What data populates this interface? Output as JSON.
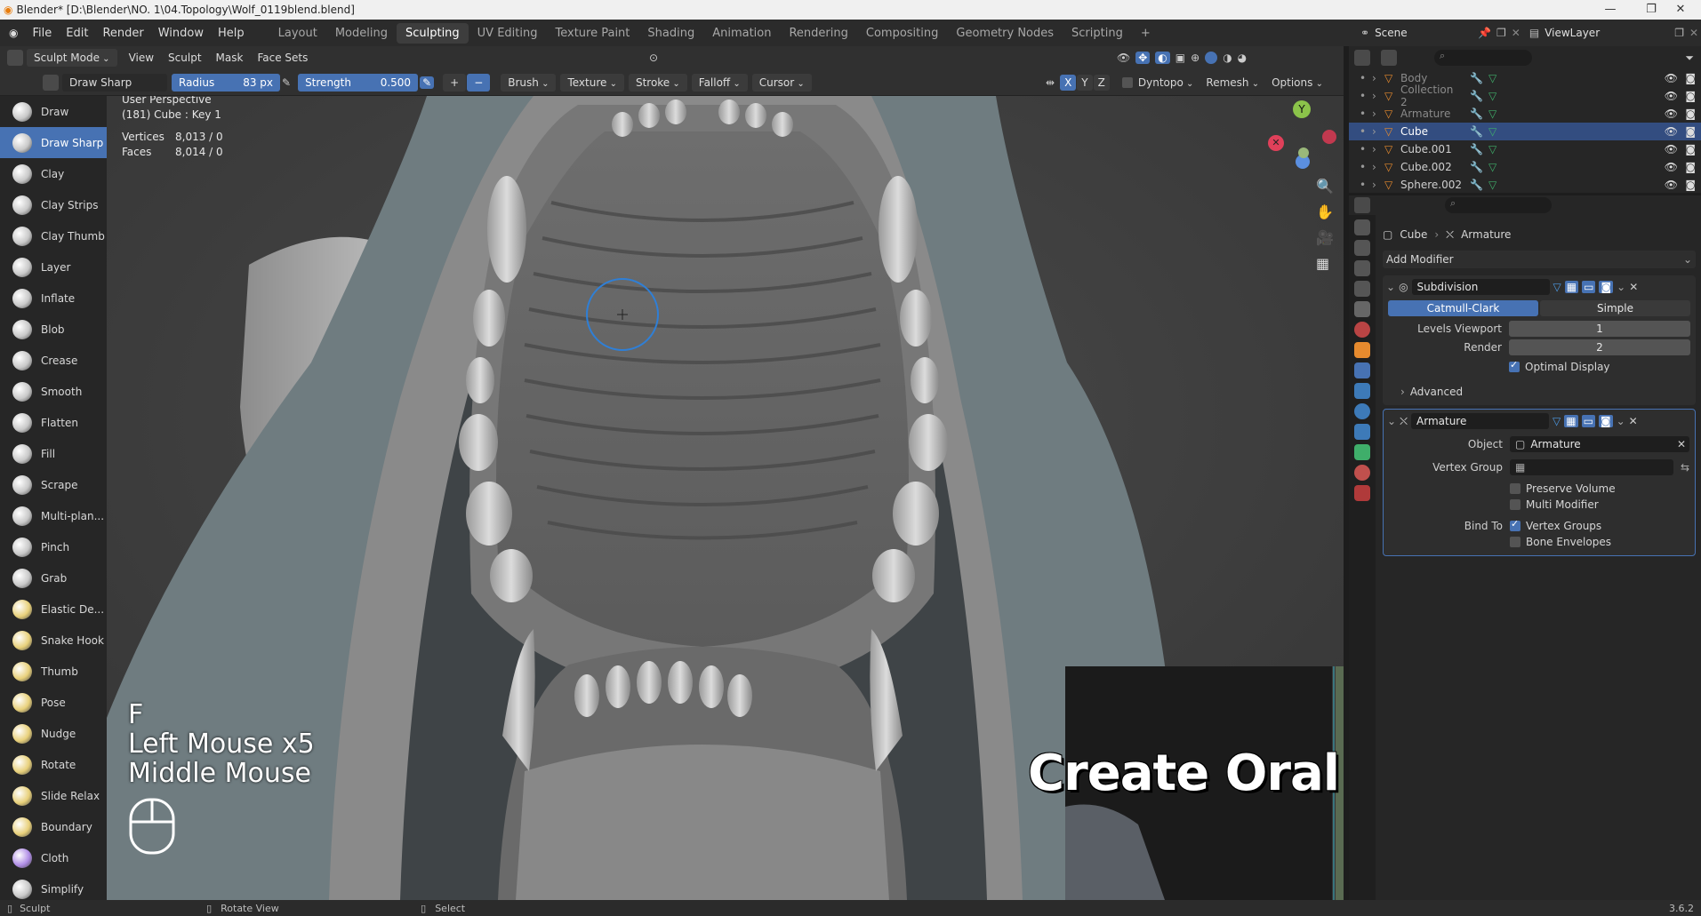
{
  "title": "Blender* [D:\\Blender\\NO. 1\\04.Topology\\Wolf_0119blend.blend]",
  "menu": [
    "File",
    "Edit",
    "Render",
    "Window",
    "Help"
  ],
  "workspaces": [
    "Layout",
    "Modeling",
    "Sculpting",
    "UV Editing",
    "Texture Paint",
    "Shading",
    "Animation",
    "Rendering",
    "Compositing",
    "Geometry Nodes",
    "Scripting"
  ],
  "active_workspace": "Sculpting",
  "scene": "Scene",
  "view_layer": "ViewLayer",
  "viewport_header": {
    "mode": "Sculpt Mode",
    "menus": [
      "View",
      "Sculpt",
      "Mask",
      "Face Sets"
    ]
  },
  "tool_header": {
    "brush_name": "Draw Sharp",
    "radius_label": "Radius",
    "radius_value": "83 px",
    "strength_label": "Strength",
    "strength_value": "0.500",
    "plus": "+",
    "minus": "−",
    "menus": [
      "Brush",
      "Texture",
      "Stroke",
      "Falloff",
      "Cursor"
    ],
    "axes": [
      "X",
      "Y",
      "Z"
    ],
    "dyntopo": "Dyntopo",
    "remesh": "Remesh",
    "options": "Options"
  },
  "tools": [
    {
      "label": "Draw",
      "color": "#c8c8c8"
    },
    {
      "label": "Draw Sharp",
      "color": "#c8c8c8",
      "active": true
    },
    {
      "label": "Clay",
      "color": "#c8c8c8"
    },
    {
      "label": "Clay Strips",
      "color": "#c8c8c8"
    },
    {
      "label": "Clay Thumb",
      "color": "#c8c8c8"
    },
    {
      "label": "Layer",
      "color": "#c8c8c8"
    },
    {
      "label": "Inflate",
      "color": "#c8c8c8"
    },
    {
      "label": "Blob",
      "color": "#c8c8c8"
    },
    {
      "label": "Crease",
      "color": "#c8c8c8"
    },
    {
      "label": "Smooth",
      "color": "#c8c8c8"
    },
    {
      "label": "Flatten",
      "color": "#c8c8c8"
    },
    {
      "label": "Fill",
      "color": "#c8c8c8"
    },
    {
      "label": "Scrape",
      "color": "#c8c8c8"
    },
    {
      "label": "Multi-plan...",
      "color": "#c8c8c8"
    },
    {
      "label": "Pinch",
      "color": "#c8c8c8"
    },
    {
      "label": "Grab",
      "color": "#c8c8c8"
    },
    {
      "label": "Elastic De...",
      "color": "#e8d07a"
    },
    {
      "label": "Snake Hook",
      "color": "#e8d07a"
    },
    {
      "label": "Thumb",
      "color": "#e8d07a"
    },
    {
      "label": "Pose",
      "color": "#e8d07a"
    },
    {
      "label": "Nudge",
      "color": "#e8d07a"
    },
    {
      "label": "Rotate",
      "color": "#e8d07a"
    },
    {
      "label": "Slide Relax",
      "color": "#e8d07a"
    },
    {
      "label": "Boundary",
      "color": "#e8d07a"
    },
    {
      "label": "Cloth",
      "color": "#b08de6"
    },
    {
      "label": "Simplify",
      "color": "#c8c8c8"
    }
  ],
  "viewport_info": {
    "line1": "User Perspective",
    "line2": "(181) Cube : Key 1",
    "vertices_label": "Vertices",
    "vertices_value": "8,013 / 0",
    "faces_label": "Faces",
    "faces_value": "8,014 / 0"
  },
  "keys_overlay": {
    "line1": "F",
    "line2": "Left Mouse x5",
    "line3": "Middle Mouse"
  },
  "video_title": "Create Oral Structure",
  "gizmo": {
    "y_label": "Y",
    "x_color": "#e0405a",
    "y_color": "#8bc34a",
    "z_color": "#5b8fe0"
  },
  "outliner": {
    "rows": [
      {
        "name": "Body",
        "dim": true
      },
      {
        "name": "Collection 2",
        "dim": true
      },
      {
        "name": "Armature",
        "dim": true
      },
      {
        "name": "Cube",
        "selected": true
      },
      {
        "name": "Cube.001"
      },
      {
        "name": "Cube.002"
      },
      {
        "name": "Sphere.002"
      }
    ]
  },
  "properties": {
    "breadcrumb_object": "Cube",
    "breadcrumb_modifier": "Armature",
    "add_modifier": "Add Modifier",
    "subdivision": {
      "name": "Subdivision",
      "tab_active": "Catmull-Clark",
      "tab_other": "Simple",
      "levels_label": "Levels Viewport",
      "levels_value": "1",
      "render_label": "Render",
      "render_value": "2",
      "optimal": "Optimal Display",
      "advanced": "Advanced"
    },
    "armature": {
      "name": "Armature",
      "object_label": "Object",
      "object_value": "Armature",
      "vgroup_label": "Vertex Group",
      "preserve": "Preserve Volume",
      "multi": "Multi Modifier",
      "bind_label": "Bind To",
      "vertex_groups": "Vertex Groups",
      "bone_env": "Bone Envelopes"
    }
  },
  "status": {
    "left": "Sculpt",
    "mid": "Rotate View",
    "right": "Select",
    "version": "3.6.2"
  },
  "colors": {
    "accent": "#4772b3",
    "selection": "#334d80",
    "object_orange": "#e68a2e"
  }
}
